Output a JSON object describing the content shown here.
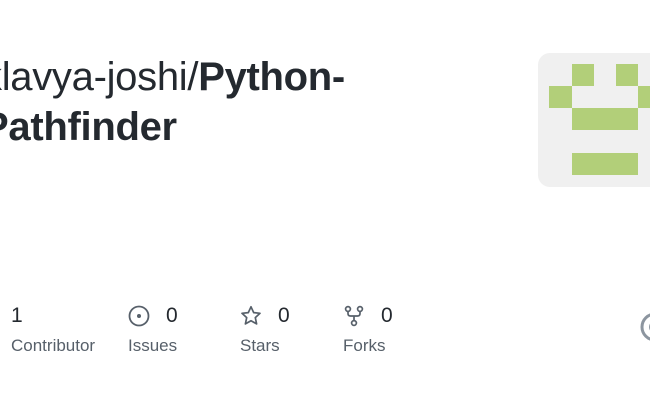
{
  "repo": {
    "owner": "klavya-joshi/",
    "name_line1": "Python-",
    "name_line2": "Pathfinder"
  },
  "avatar": {
    "icon": "identicon",
    "color": "#b2cf79",
    "background": "#f0f0f0"
  },
  "stats": {
    "contributors": {
      "count": "1",
      "label": "Contributor"
    },
    "issues": {
      "count": "0",
      "label": "Issues",
      "icon": "issue-circle-icon"
    },
    "stars": {
      "count": "0",
      "label": "Stars",
      "icon": "star-icon"
    },
    "forks": {
      "count": "0",
      "label": "Forks",
      "icon": "fork-icon"
    }
  },
  "colors": {
    "text": "#24292f",
    "muted": "#57606a",
    "icon": "#57606a"
  }
}
